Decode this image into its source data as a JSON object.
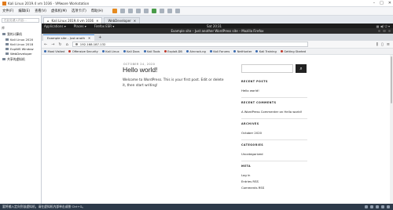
{
  "vmware": {
    "title": "Kali Linux 2019.4 vm 1036 - VMware Workstation",
    "menu": [
      "文件(F)",
      "编辑(E)",
      "查看(V)",
      "虚拟机(M)",
      "选项卡(T)",
      "帮助(H)"
    ],
    "library": {
      "search_placeholder": "在此处键入内容…",
      "header": "库",
      "root": "我的计算机",
      "vms": [
        "Kali Linux 2020",
        "Kali Linux 2018",
        "ExpNIS Window",
        "WebDeveloper"
      ],
      "shared": "共享的虚拟机"
    },
    "tabs": [
      {
        "label": "Kali Linux 2019.4 vm 1036",
        "active": true
      },
      {
        "label": "WebDeveloper",
        "active": false
      }
    ],
    "status_text": "要将输入定向到该虚拟机，请在虚拟机内部单击或按 Ctrl+G。"
  },
  "gnome": {
    "applications": "Applications ▾",
    "places": "Places ▾",
    "firefox": "Firefox ESR ▾",
    "clock": "Sat 20∶31"
  },
  "firefox": {
    "window_title": "Example site – Just another WordPress site – Mozilla Firefox",
    "tab_label": "Example site – Just anoth",
    "url": "192.168.187.132",
    "bookmarks": [
      {
        "label": "Most Visited",
        "icon": "gear-icon"
      },
      {
        "label": "Offensive Security",
        "icon": "globe-icon"
      },
      {
        "label": "Kali Linux",
        "icon": "kali-icon"
      },
      {
        "label": "Kali Docs",
        "icon": "kali-icon"
      },
      {
        "label": "Kali Tools",
        "icon": "kali-icon"
      },
      {
        "label": "Exploit-DB",
        "icon": "exploit-icon"
      },
      {
        "label": "Aircrack-ng",
        "icon": "globe-icon"
      },
      {
        "label": "Kali Forums",
        "icon": "kali-icon"
      },
      {
        "label": "NetHunter",
        "icon": "kali-icon"
      },
      {
        "label": "Kali Training",
        "icon": "kali-icon"
      },
      {
        "label": "Getting Started",
        "icon": "firefox-icon"
      }
    ]
  },
  "page": {
    "post_date": "OCTOBER 24, 2020",
    "post_title": "Hello world!",
    "post_body": "Welcome to WordPress. This is your first post. Edit or delete it, then start writing!",
    "widgets": [
      {
        "title": "RECENT POSTS",
        "items": [
          "Hello world!"
        ]
      },
      {
        "title": "RECENT COMMENTS",
        "items": [
          "A WordPress Commenter on Hello world!"
        ]
      },
      {
        "title": "ARCHIVES",
        "items": [
          "October 2020"
        ]
      },
      {
        "title": "CATEGORIES",
        "items": [
          "Uncategorized"
        ]
      },
      {
        "title": "META",
        "items": [
          "Log in",
          "Entries RSS",
          "Comments RSS"
        ]
      }
    ]
  }
}
